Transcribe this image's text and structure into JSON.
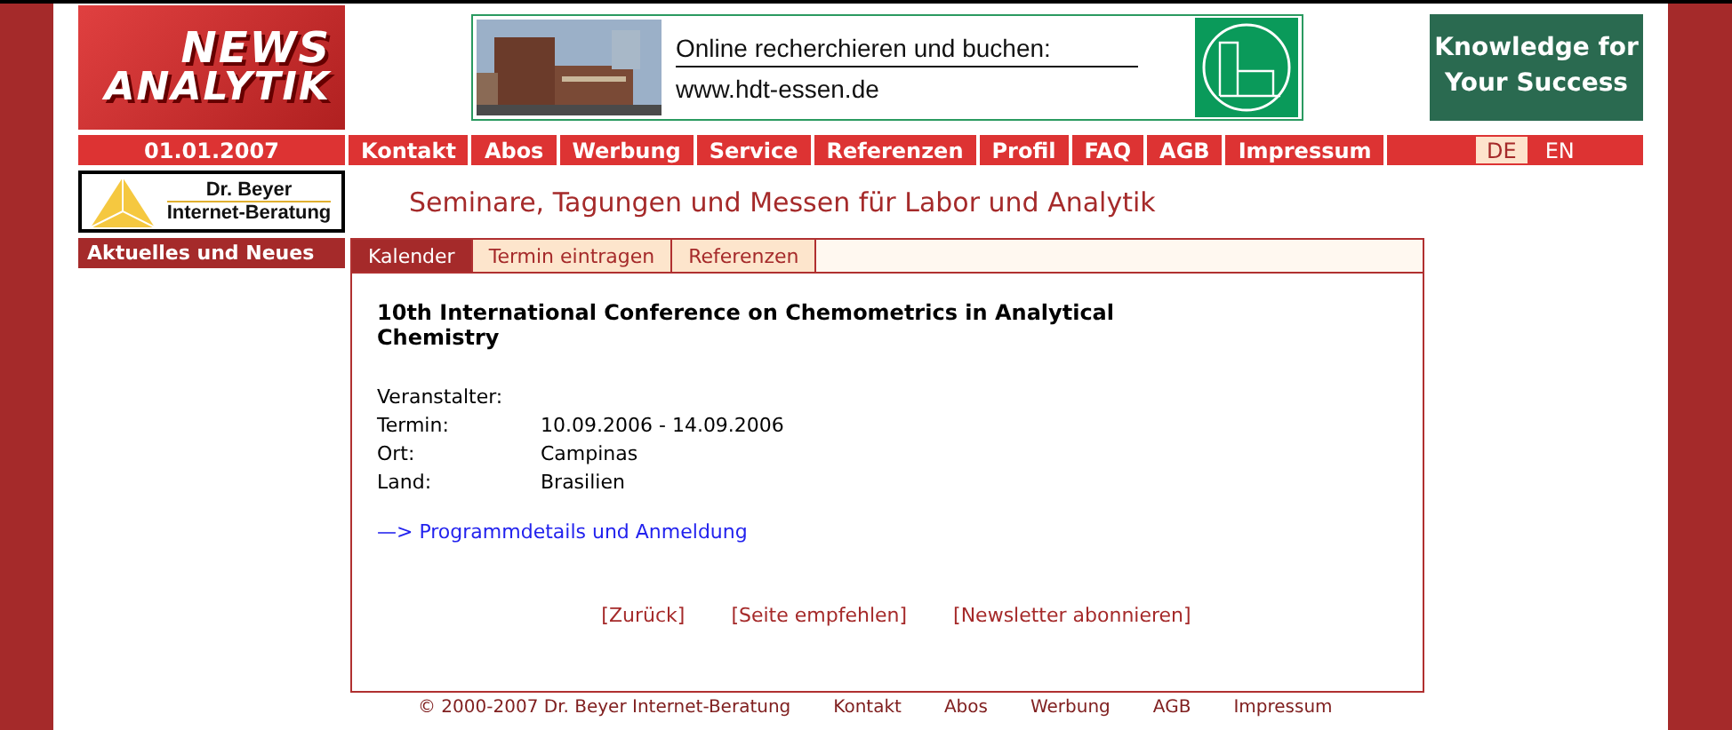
{
  "header": {
    "logo": {
      "line_1": "NEWS",
      "line_2": "ANALYTIK"
    },
    "banner": {
      "headline": "Online recherchieren und buchen:",
      "url": "www.hdt-essen.de"
    },
    "slogan": "Knowledge for Your Success"
  },
  "date": "01.01.2007",
  "nav": [
    {
      "label": "Kontakt"
    },
    {
      "label": "Abos"
    },
    {
      "label": "Werbung"
    },
    {
      "label": "Service"
    },
    {
      "label": "Referenzen"
    },
    {
      "label": "Profil"
    },
    {
      "label": "FAQ"
    },
    {
      "label": "AGB"
    },
    {
      "label": "Impressum"
    }
  ],
  "languages": [
    {
      "label": "DE",
      "selected": true
    },
    {
      "label": "EN",
      "selected": false
    }
  ],
  "sponsor_logo": {
    "line_1": "Dr. Beyer",
    "line_2": "Internet-Beratung"
  },
  "page_heading": "Seminare, Tagungen und Messen für Labor und Analytik",
  "sidebar": {
    "heading": "Aktuelles und Neues"
  },
  "tabs": [
    {
      "label": "Kalender",
      "selected": true
    },
    {
      "label": "Termin eintragen",
      "selected": false
    },
    {
      "label": "Referenzen",
      "selected": false
    }
  ],
  "event": {
    "title": "10th International Conference on Chemometrics in Analytical Chemistry",
    "details": [
      {
        "label": "Veranstalter:"
      },
      {
        "label": "Termin:",
        "value": "10.09.2006 - 14.09.2006"
      },
      {
        "label": "Ort:",
        "value": "Campinas"
      },
      {
        "label": "Land:",
        "value": "Brasilien"
      }
    ],
    "link": "—> Programmdetails und Anmeldung"
  },
  "actions": [
    "[Zurück]",
    "[Seite empfehlen]",
    "[Newsletter abonnieren]"
  ],
  "footer": {
    "copyright": "© 2000-2007  Dr. Beyer Internet-Beratung",
    "links": [
      "Kontakt",
      "Abos",
      "Werbung",
      "AGB",
      "Impressum"
    ]
  }
}
